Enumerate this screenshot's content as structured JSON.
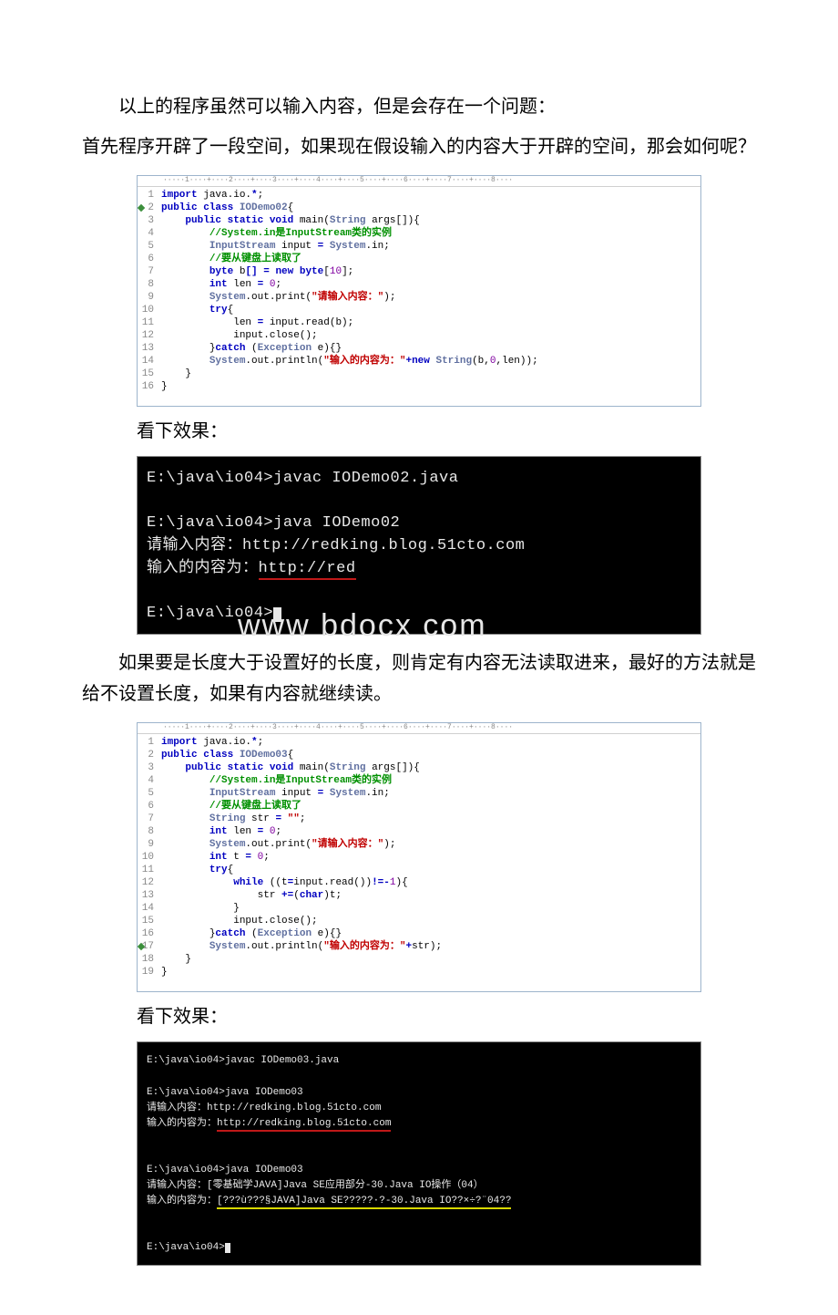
{
  "paragraphs": {
    "p1": "以上的程序虽然可以输入内容，但是会存在一个问题：",
    "p2": "首先程序开辟了一段空间，如果现在假设输入的内容大于开辟的空间，那会如何呢？",
    "p3": "如果要是长度大于设置好的长度，则肯定有内容无法读取进来，最好的方法就是给不设置长度，如果有内容就继续读。"
  },
  "labels": {
    "see_result": "看下效果："
  },
  "ruler": "·····1····+····2····+····3····+····4····+····5····+····6····+····7····+····8····",
  "watermark": "www    bdocx   com",
  "code1": {
    "marker_row": 2,
    "lines": [
      {
        "n": "1",
        "seg": [
          {
            "t": "import ",
            "c": "kw"
          },
          {
            "t": "java.io.",
            "c": "plain"
          },
          {
            "t": "*",
            "c": "kw"
          },
          {
            "t": ";",
            "c": "plain"
          }
        ]
      },
      {
        "n": "2",
        "seg": [
          {
            "t": "public class ",
            "c": "kw"
          },
          {
            "t": "IODemo02",
            "c": "cls"
          },
          {
            "t": "{",
            "c": "plain"
          }
        ]
      },
      {
        "n": "3",
        "seg": [
          {
            "t": "    ",
            "c": "plain"
          },
          {
            "t": "public static void ",
            "c": "kw"
          },
          {
            "t": "main",
            "c": "plain"
          },
          {
            "t": "(",
            "c": "plain"
          },
          {
            "t": "String ",
            "c": "cls"
          },
          {
            "t": "args",
            "c": "plain"
          },
          {
            "t": "[]){",
            "c": "plain"
          }
        ]
      },
      {
        "n": "4",
        "seg": [
          {
            "t": "        ",
            "c": "plain"
          },
          {
            "t": "//System.in是InputStream类的实例",
            "c": "cmt"
          }
        ]
      },
      {
        "n": "5",
        "seg": [
          {
            "t": "        ",
            "c": "plain"
          },
          {
            "t": "InputStream ",
            "c": "cls"
          },
          {
            "t": "input ",
            "c": "plain"
          },
          {
            "t": "= ",
            "c": "kw"
          },
          {
            "t": "System",
            "c": "cls"
          },
          {
            "t": ".in;",
            "c": "plain"
          }
        ]
      },
      {
        "n": "6",
        "seg": [
          {
            "t": "        ",
            "c": "plain"
          },
          {
            "t": "//要从键盘上读取了",
            "c": "cmt"
          }
        ]
      },
      {
        "n": "7",
        "seg": [
          {
            "t": "        ",
            "c": "plain"
          },
          {
            "t": "byte ",
            "c": "kw"
          },
          {
            "t": "b",
            "c": "plain"
          },
          {
            "t": "[] = ",
            "c": "kw"
          },
          {
            "t": "new byte",
            "c": "kw"
          },
          {
            "t": "[",
            "c": "plain"
          },
          {
            "t": "10",
            "c": "num"
          },
          {
            "t": "];",
            "c": "plain"
          }
        ]
      },
      {
        "n": "8",
        "seg": [
          {
            "t": "        ",
            "c": "plain"
          },
          {
            "t": "int ",
            "c": "kw"
          },
          {
            "t": "len ",
            "c": "plain"
          },
          {
            "t": "= ",
            "c": "kw"
          },
          {
            "t": "0",
            "c": "num"
          },
          {
            "t": ";",
            "c": "plain"
          }
        ]
      },
      {
        "n": "9",
        "seg": [
          {
            "t": "        ",
            "c": "plain"
          },
          {
            "t": "System",
            "c": "cls"
          },
          {
            "t": ".out.print(",
            "c": "plain"
          },
          {
            "t": "\"请输入内容：\"",
            "c": "str"
          },
          {
            "t": ");",
            "c": "plain"
          }
        ]
      },
      {
        "n": "10",
        "seg": [
          {
            "t": "        ",
            "c": "plain"
          },
          {
            "t": "try",
            "c": "kw"
          },
          {
            "t": "{",
            "c": "plain"
          }
        ]
      },
      {
        "n": "11",
        "seg": [
          {
            "t": "            len ",
            "c": "plain"
          },
          {
            "t": "= ",
            "c": "kw"
          },
          {
            "t": "input.read(b);",
            "c": "plain"
          }
        ]
      },
      {
        "n": "12",
        "seg": [
          {
            "t": "            input.close();",
            "c": "plain"
          }
        ]
      },
      {
        "n": "13",
        "seg": [
          {
            "t": "        ",
            "c": "plain"
          },
          {
            "t": "}",
            "c": "plain"
          },
          {
            "t": "catch ",
            "c": "kw"
          },
          {
            "t": "(",
            "c": "plain"
          },
          {
            "t": "Exception ",
            "c": "cls"
          },
          {
            "t": "e){}",
            "c": "plain"
          }
        ]
      },
      {
        "n": "14",
        "seg": [
          {
            "t": "        ",
            "c": "plain"
          },
          {
            "t": "System",
            "c": "cls"
          },
          {
            "t": ".out.println(",
            "c": "plain"
          },
          {
            "t": "\"输入的内容为：\"",
            "c": "str"
          },
          {
            "t": "+",
            "c": "kw"
          },
          {
            "t": "new ",
            "c": "kw"
          },
          {
            "t": "String",
            "c": "cls"
          },
          {
            "t": "(b,",
            "c": "plain"
          },
          {
            "t": "0",
            "c": "num"
          },
          {
            "t": ",len));",
            "c": "plain"
          }
        ]
      },
      {
        "n": "15",
        "seg": [
          {
            "t": "    }",
            "c": "plain"
          }
        ]
      },
      {
        "n": "16",
        "seg": [
          {
            "t": "}",
            "c": "plain"
          }
        ]
      }
    ]
  },
  "terminal1": {
    "lines": [
      "E:\\java\\io04>javac IODemo02.java",
      "",
      "E:\\java\\io04>java IODemo02",
      {
        "pre": "请输入内容：http://redking.blog.51cto.com"
      },
      {
        "pre": "输入的内容为：",
        "ul": "http://red"
      },
      "",
      {
        "pre": "E:\\java\\io04>",
        "cursor": true
      }
    ]
  },
  "code2": {
    "marker_row": 17,
    "lines": [
      {
        "n": "1",
        "seg": [
          {
            "t": "import ",
            "c": "kw"
          },
          {
            "t": "java.io.",
            "c": "plain"
          },
          {
            "t": "*",
            "c": "kw"
          },
          {
            "t": ";",
            "c": "plain"
          }
        ]
      },
      {
        "n": "2",
        "seg": [
          {
            "t": "public class ",
            "c": "kw"
          },
          {
            "t": "IODemo03",
            "c": "cls"
          },
          {
            "t": "{",
            "c": "plain"
          }
        ]
      },
      {
        "n": "3",
        "seg": [
          {
            "t": "    ",
            "c": "plain"
          },
          {
            "t": "public static void ",
            "c": "kw"
          },
          {
            "t": "main",
            "c": "plain"
          },
          {
            "t": "(",
            "c": "plain"
          },
          {
            "t": "String ",
            "c": "cls"
          },
          {
            "t": "args",
            "c": "plain"
          },
          {
            "t": "[]){",
            "c": "plain"
          }
        ]
      },
      {
        "n": "4",
        "seg": [
          {
            "t": "        ",
            "c": "plain"
          },
          {
            "t": "//System.in是InputStream类的实例",
            "c": "cmt"
          }
        ]
      },
      {
        "n": "5",
        "seg": [
          {
            "t": "        ",
            "c": "plain"
          },
          {
            "t": "InputStream ",
            "c": "cls"
          },
          {
            "t": "input ",
            "c": "plain"
          },
          {
            "t": "= ",
            "c": "kw"
          },
          {
            "t": "System",
            "c": "cls"
          },
          {
            "t": ".in;",
            "c": "plain"
          }
        ]
      },
      {
        "n": "6",
        "seg": [
          {
            "t": "        ",
            "c": "plain"
          },
          {
            "t": "//要从键盘上读取了",
            "c": "cmt"
          }
        ]
      },
      {
        "n": "7",
        "seg": [
          {
            "t": "        ",
            "c": "plain"
          },
          {
            "t": "String ",
            "c": "cls"
          },
          {
            "t": "str ",
            "c": "plain"
          },
          {
            "t": "= ",
            "c": "kw"
          },
          {
            "t": "\"\"",
            "c": "str"
          },
          {
            "t": ";",
            "c": "plain"
          }
        ]
      },
      {
        "n": "8",
        "seg": [
          {
            "t": "        ",
            "c": "plain"
          },
          {
            "t": "int ",
            "c": "kw"
          },
          {
            "t": "len ",
            "c": "plain"
          },
          {
            "t": "= ",
            "c": "kw"
          },
          {
            "t": "0",
            "c": "num"
          },
          {
            "t": ";",
            "c": "plain"
          }
        ]
      },
      {
        "n": "9",
        "seg": [
          {
            "t": "        ",
            "c": "plain"
          },
          {
            "t": "System",
            "c": "cls"
          },
          {
            "t": ".out.print(",
            "c": "plain"
          },
          {
            "t": "\"请输入内容：\"",
            "c": "str"
          },
          {
            "t": ");",
            "c": "plain"
          }
        ]
      },
      {
        "n": "10",
        "seg": [
          {
            "t": "        ",
            "c": "plain"
          },
          {
            "t": "int ",
            "c": "kw"
          },
          {
            "t": "t ",
            "c": "plain"
          },
          {
            "t": "= ",
            "c": "kw"
          },
          {
            "t": "0",
            "c": "num"
          },
          {
            "t": ";",
            "c": "plain"
          }
        ]
      },
      {
        "n": "11",
        "seg": [
          {
            "t": "        ",
            "c": "plain"
          },
          {
            "t": "try",
            "c": "kw"
          },
          {
            "t": "{",
            "c": "plain"
          }
        ]
      },
      {
        "n": "12",
        "seg": [
          {
            "t": "            ",
            "c": "plain"
          },
          {
            "t": "while ",
            "c": "kw"
          },
          {
            "t": "((t",
            "c": "plain"
          },
          {
            "t": "=",
            "c": "kw"
          },
          {
            "t": "input.read())",
            "c": "plain"
          },
          {
            "t": "!=-",
            "c": "kw"
          },
          {
            "t": "1",
            "c": "num"
          },
          {
            "t": "){",
            "c": "plain"
          }
        ]
      },
      {
        "n": "13",
        "seg": [
          {
            "t": "                str ",
            "c": "plain"
          },
          {
            "t": "+=",
            "c": "kw"
          },
          {
            "t": "(",
            "c": "plain"
          },
          {
            "t": "char",
            "c": "kw"
          },
          {
            "t": ")t;",
            "c": "plain"
          }
        ]
      },
      {
        "n": "14",
        "seg": [
          {
            "t": "            }",
            "c": "plain"
          }
        ]
      },
      {
        "n": "15",
        "seg": [
          {
            "t": "            input.close();",
            "c": "plain"
          }
        ]
      },
      {
        "n": "16",
        "seg": [
          {
            "t": "        ",
            "c": "plain"
          },
          {
            "t": "}",
            "c": "plain"
          },
          {
            "t": "catch ",
            "c": "kw"
          },
          {
            "t": "(",
            "c": "plain"
          },
          {
            "t": "Exception ",
            "c": "cls"
          },
          {
            "t": "e){}",
            "c": "plain"
          }
        ]
      },
      {
        "n": "17",
        "seg": [
          {
            "t": "        ",
            "c": "plain"
          },
          {
            "t": "System",
            "c": "cls"
          },
          {
            "t": ".out.println(",
            "c": "plain"
          },
          {
            "t": "\"输入的内容为：\"",
            "c": "str"
          },
          {
            "t": "+",
            "c": "kw"
          },
          {
            "t": "str);",
            "c": "plain"
          }
        ]
      },
      {
        "n": "18",
        "seg": [
          {
            "t": "    }",
            "c": "plain"
          }
        ]
      },
      {
        "n": "19",
        "seg": [
          {
            "t": "}",
            "c": "plain"
          }
        ]
      }
    ]
  },
  "terminal2": {
    "lines": [
      "E:\\java\\io04>javac IODemo03.java",
      "",
      "E:\\java\\io04>java IODemo03",
      "请输入内容：http://redking.blog.51cto.com",
      {
        "pre": "输入的内容为：",
        "ul": "http://redking.blog.51cto.com"
      },
      "",
      "",
      "E:\\java\\io04>java IODemo03",
      "请输入内容：[零基础学JAVA]Java SE应用部分-30.Java IO操作（04）",
      {
        "pre": "输入的内容为：",
        "uly": "[???ù???§JAVA]Java SE?????·?-30.Java IO??×÷?¨04??"
      },
      "",
      "",
      {
        "pre": "E:\\java\\io04>",
        "cursor": true
      }
    ]
  }
}
